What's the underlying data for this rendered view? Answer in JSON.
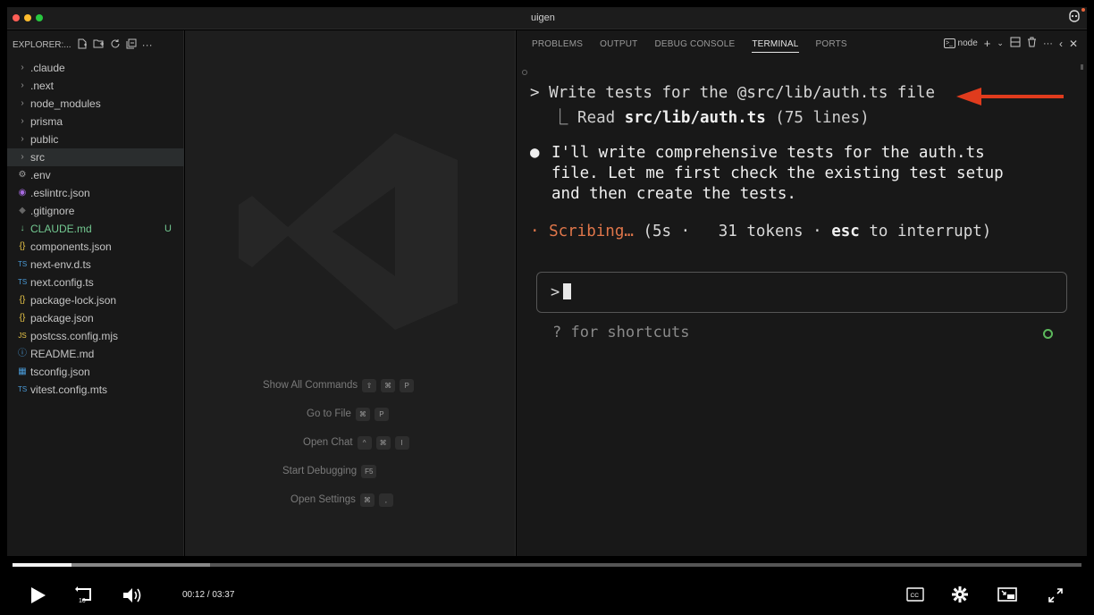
{
  "window": {
    "title": "uigen",
    "traffic_lights": [
      "#ff5f57",
      "#febc2e",
      "#28c840"
    ]
  },
  "sidebar": {
    "header": "EXPLORER:...",
    "items": [
      {
        "label": ".claude",
        "type": "folder",
        "icon": "chevron-right-icon"
      },
      {
        "label": ".next",
        "type": "folder",
        "icon": "chevron-right-icon"
      },
      {
        "label": "node_modules",
        "type": "folder",
        "icon": "chevron-right-icon"
      },
      {
        "label": "prisma",
        "type": "folder",
        "icon": "chevron-right-icon"
      },
      {
        "label": "public",
        "type": "folder",
        "icon": "chevron-right-icon"
      },
      {
        "label": "src",
        "type": "folder",
        "icon": "chevron-right-icon",
        "selected": true
      },
      {
        "label": ".env",
        "type": "file",
        "icon": "gear-icon"
      },
      {
        "label": ".eslintrc.json",
        "type": "file",
        "icon": "eslint-icon"
      },
      {
        "label": ".gitignore",
        "type": "file",
        "icon": "git-icon"
      },
      {
        "label": "CLAUDE.md",
        "type": "file",
        "icon": "markdown-icon",
        "status": "U"
      },
      {
        "label": "components.json",
        "type": "file",
        "icon": "json-icon"
      },
      {
        "label": "next-env.d.ts",
        "type": "file",
        "icon": "typescript-icon"
      },
      {
        "label": "next.config.ts",
        "type": "file",
        "icon": "typescript-icon"
      },
      {
        "label": "package-lock.json",
        "type": "file",
        "icon": "json-icon"
      },
      {
        "label": "package.json",
        "type": "file",
        "icon": "json-icon"
      },
      {
        "label": "postcss.config.mjs",
        "type": "file",
        "icon": "javascript-icon"
      },
      {
        "label": "README.md",
        "type": "file",
        "icon": "info-icon"
      },
      {
        "label": "tsconfig.json",
        "type": "file",
        "icon": "tsconfig-icon"
      },
      {
        "label": "vitest.config.mts",
        "type": "file",
        "icon": "typescript-icon"
      }
    ]
  },
  "editor": {
    "shortcuts": [
      {
        "label": "Show All Commands",
        "keys": [
          "⇧",
          "⌘",
          "P"
        ]
      },
      {
        "label": "Go to File",
        "keys": [
          "⌘",
          "P"
        ]
      },
      {
        "label": "Open Chat",
        "keys": [
          "^",
          "⌘",
          "I"
        ]
      },
      {
        "label": "Start Debugging",
        "keys": [
          "F5"
        ]
      },
      {
        "label": "Open Settings",
        "keys": [
          "⌘",
          ","
        ]
      }
    ]
  },
  "panel": {
    "tabs": [
      "PROBLEMS",
      "OUTPUT",
      "DEBUG CONSOLE",
      "TERMINAL",
      "PORTS"
    ],
    "active_tab": "TERMINAL",
    "terminal_name": "node"
  },
  "terminal": {
    "prompt_prefix": "> ",
    "user_prompt": "Write tests for the @src/lib/auth.ts file",
    "read_prefix": "⎿ Read ",
    "read_path": "src/lib/auth.ts",
    "read_suffix": " (75 lines)",
    "assistant_lines": [
      "I'll write comprehensive tests for the auth.ts",
      "file. Let me first check the existing test setup",
      "and then create the tests."
    ],
    "status_word": "Scribing…",
    "status_time": " (5s · ",
    "status_tokens": "  31 tokens · ",
    "status_key": "esc",
    "status_end": " to interrupt)",
    "input_prompt": ">",
    "hint": "? for shortcuts"
  },
  "video": {
    "current_time": "00:12",
    "duration": "03:37",
    "separator": " / ",
    "played_fraction": 0.055,
    "buffered_fraction": 0.185,
    "skip_seconds": "10",
    "cc_label": "CC"
  }
}
